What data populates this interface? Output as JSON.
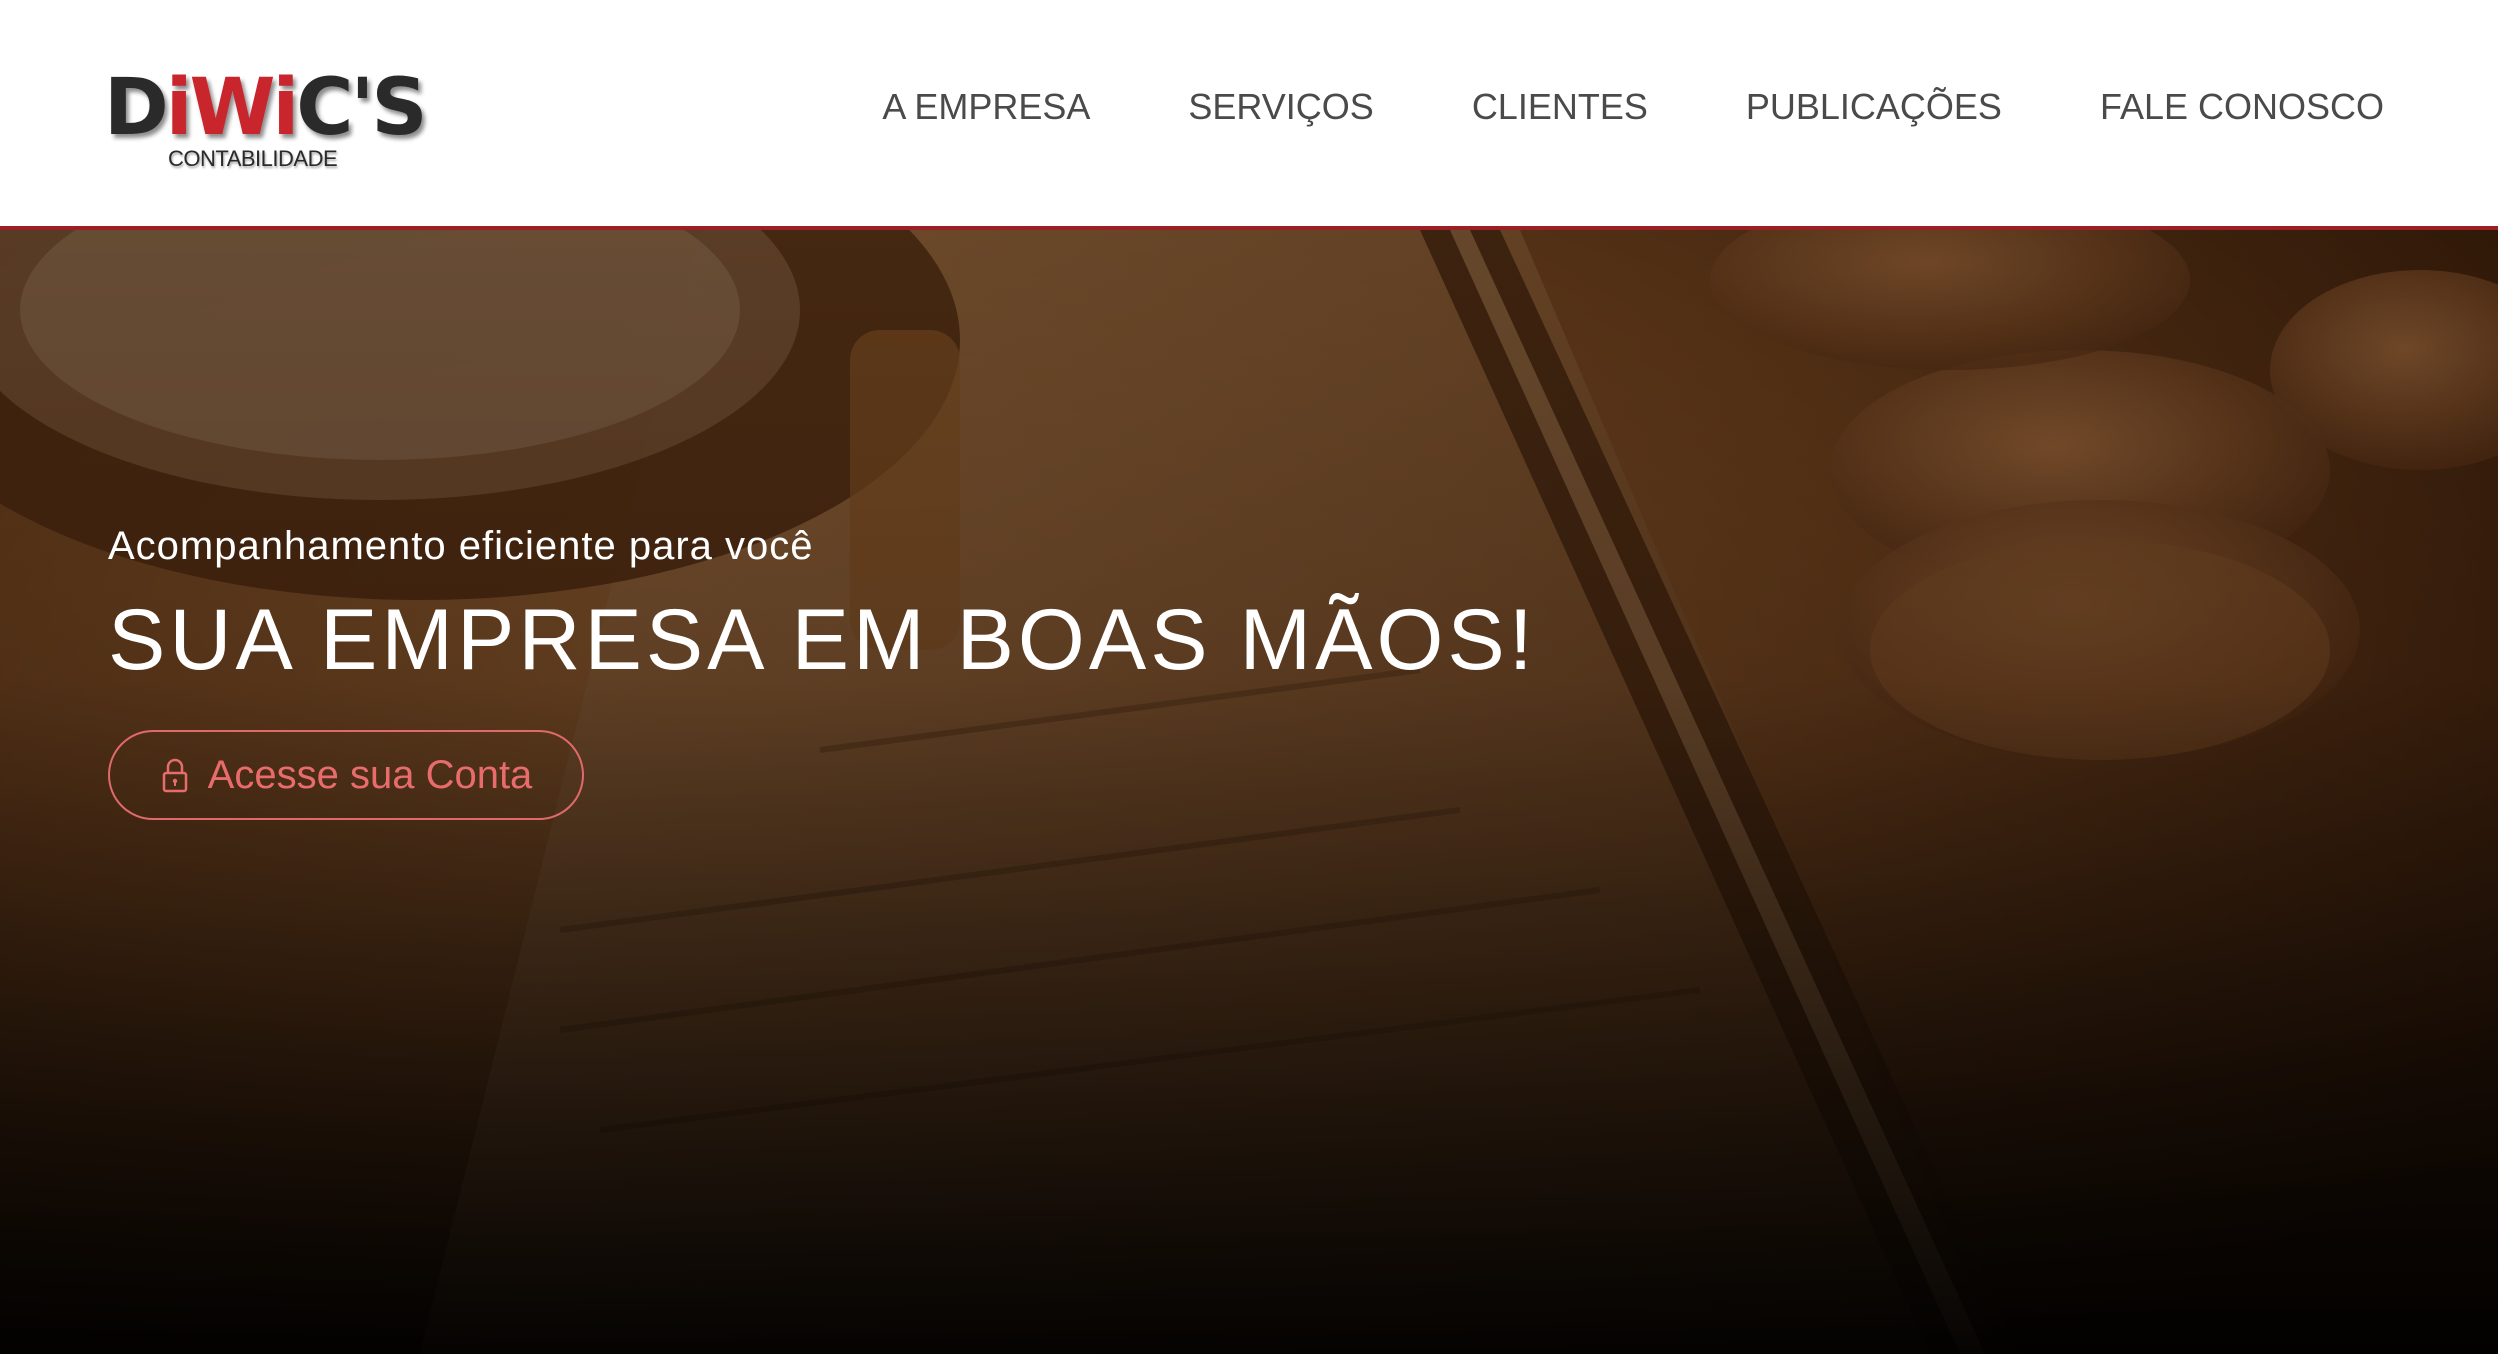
{
  "header": {
    "logo": {
      "name_part1": "D",
      "name_accent": "iWi",
      "name_part2": "C'S",
      "subtitle": "CONTABILIDADE"
    },
    "nav": [
      {
        "label": "A EMPRESA"
      },
      {
        "label": "SERVIÇOS"
      },
      {
        "label": "CLIENTES"
      },
      {
        "label": "PUBLICAÇÕES"
      },
      {
        "label": "FALE CONOSCO"
      }
    ]
  },
  "hero": {
    "tagline": "Acompanhamento eficiente para você",
    "title": "SUA EMPRESA EM BOAS MÃOS!",
    "cta_label": "Acesse sua Conta",
    "cta_icon": "lock-icon"
  },
  "colors": {
    "accent": "#9b2023",
    "cta": "#e86c6c",
    "nav_text": "#4a4a4a"
  }
}
